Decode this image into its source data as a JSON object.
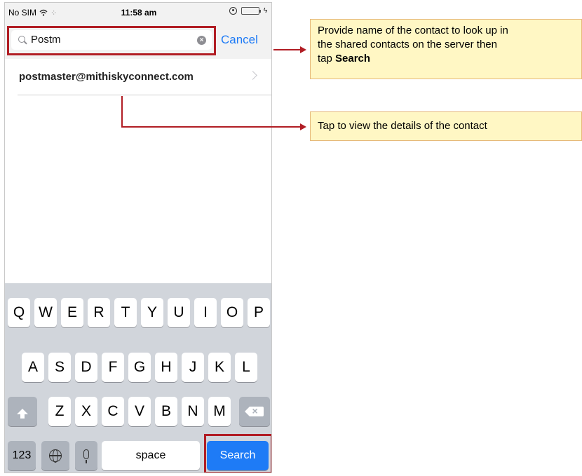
{
  "status_bar": {
    "carrier": "No SIM",
    "time": "11:58 am",
    "icons": [
      "wifi-icon",
      "activity-icon",
      "rotation-lock-icon",
      "battery-icon",
      "charging-icon"
    ]
  },
  "search": {
    "query": "Postm",
    "cancel_label": "Cancel"
  },
  "results": [
    {
      "email": "postmaster@mithiskyconnect.com"
    }
  ],
  "keyboard": {
    "row1": [
      "Q",
      "W",
      "E",
      "R",
      "T",
      "Y",
      "U",
      "I",
      "O",
      "P"
    ],
    "row2": [
      "A",
      "S",
      "D",
      "F",
      "G",
      "H",
      "J",
      "K",
      "L"
    ],
    "row3": [
      "Z",
      "X",
      "C",
      "V",
      "B",
      "N",
      "M"
    ],
    "numbers_label": "123",
    "space_label": "space",
    "search_label": "Search"
  },
  "callouts": {
    "search_hint_line1": "Provide  name of the contact to look up in",
    "search_hint_line2": "the shared contacts on the server  then",
    "search_hint_tap": "tap ",
    "search_hint_bold": "Search",
    "result_hint": "Tap to view the details of the contact"
  },
  "colors": {
    "accent": "#1e7bf6",
    "highlight": "#b11d24",
    "callout_bg": "#fff7c4"
  }
}
